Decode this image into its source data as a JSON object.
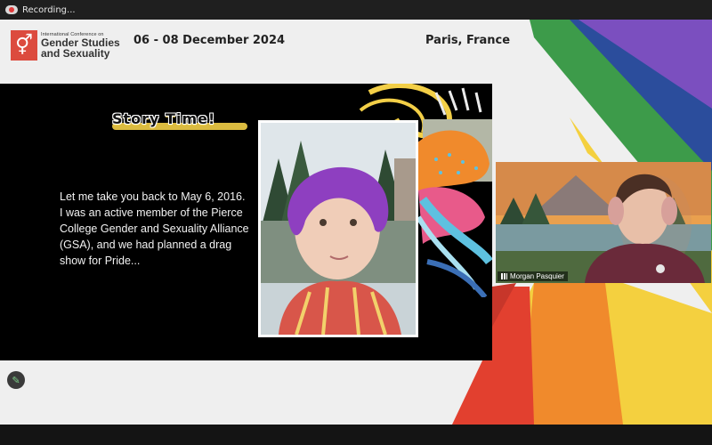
{
  "recording": {
    "label": "Recording..."
  },
  "conference": {
    "logo_small": "International Conference on",
    "logo_line1": "Gender Studies",
    "logo_line2": "and Sexuality",
    "dates": "06 - 08 December 2024",
    "location": "Paris, France"
  },
  "slide": {
    "title": "Story Time!",
    "body": "Let me take you back to May 6, 2016. I was an active member of the Pierce College Gender and Sexuality Alliance (GSA), and we had planned a drag show for Pride..."
  },
  "participant": {
    "name": "Morgan Pasquier"
  },
  "colors": {
    "logo": "#dc4b3e",
    "rainbow": [
      "#e2402f",
      "#f08a2c",
      "#f4d03f",
      "#3d9b4a",
      "#2b4d9c",
      "#7b4fbf"
    ]
  },
  "icons": {
    "pen": "pen-icon",
    "recording": "recording-icon"
  }
}
